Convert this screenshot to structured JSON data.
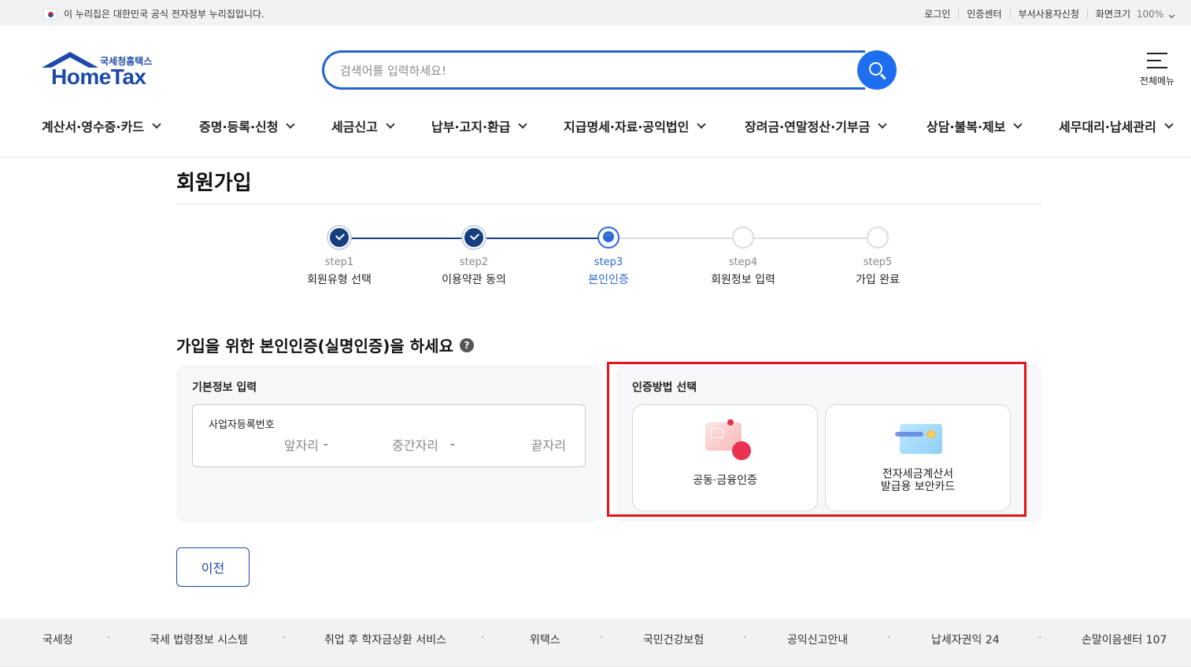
{
  "govbar": {
    "notice": "이 누리집은 대한민국 공식 전자정부 누리집입니다.",
    "links": [
      "로그인",
      "인증센터",
      "부서사용자신청"
    ],
    "zoom_label": "화면크기",
    "zoom_value": "100%"
  },
  "header": {
    "logo_small": "국세청홈택스",
    "logo_big": "HomeTax",
    "search_placeholder": "검색어를 입력하세요!",
    "all_menu": "전체메뉴"
  },
  "gnb": [
    "계산서·영수증·카드",
    "증명·등록·신청",
    "세금신고",
    "납부·고지·환급",
    "지급명세·자료·공익법인",
    "장려금·연말정산·기부금",
    "상담·불복·제보",
    "세무대리·납세관리"
  ],
  "page": {
    "title": "회원가입",
    "steps": [
      {
        "num": "step1",
        "name": "회원유형 선택",
        "state": "done"
      },
      {
        "num": "step2",
        "name": "이용약관 동의",
        "state": "done"
      },
      {
        "num": "step3",
        "name": "본인인증",
        "state": "current"
      },
      {
        "num": "step4",
        "name": "회원정보 입력",
        "state": "todo"
      },
      {
        "num": "step5",
        "name": "가입 완료",
        "state": "todo"
      }
    ],
    "section_title": "가입을 위한 본인인증(실명인증)을 하세요",
    "help_icon": "?",
    "basic": {
      "title": "기본정보 입력",
      "field_label": "사업자등록번호",
      "front": "앞자리",
      "middle": "중간자리",
      "last": "끝자리",
      "dash": "-"
    },
    "auth": {
      "title": "인증방법 선택",
      "cert_label": "공동·금융인증",
      "card_line1": "전자세금계산서",
      "card_line2": "발급용 보안카드"
    },
    "prev_button": "이전"
  },
  "footer": [
    "국세청",
    "국세 법령정보 시스템",
    "취업 후 학자금상환 서비스",
    "위택스",
    "국민건강보험",
    "공익신고안내",
    "납세자권익 24",
    "손말이음센터 107"
  ],
  "colors": {
    "brand": "#1d4aa8",
    "accent": "#2a6ad6",
    "highlight": "#e5141b"
  }
}
